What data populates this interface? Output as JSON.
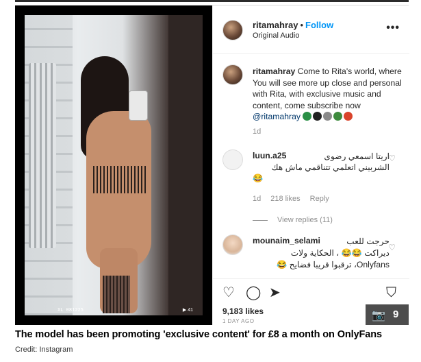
{
  "post": {
    "header": {
      "username": "ritamahray",
      "separator": "•",
      "follow_label": "Follow",
      "subtitle": "Original Audio",
      "more_label": "•••"
    },
    "caption": {
      "username": "ritamahray",
      "text": "Come to Rita's world, where You will see more up close and personal with Rita, with exclusive music and content, come subscribe now",
      "mention": "@ritamahray",
      "age": "1d",
      "emoji_colors": [
        "#2a8f46",
        "#222222",
        "#6b6b6b",
        "#3d8a3d",
        "#d9442b"
      ]
    },
    "comments": [
      {
        "username": "luun.a25",
        "text_line1": "اريتا اسمعي رضوى",
        "text_line2": "الشربيني اتعلمي تتناقمي ماش هك",
        "age": "1d",
        "likes": "218 likes",
        "reply_label": "Reply",
        "view_replies": "View replies (11)"
      },
      {
        "username": "mounaim_selami",
        "text_line1": "حرجت للعب",
        "text_line2": "ديراكت 😂😂 ، الحكاية ولات",
        "text_line3": "Onlyfans، ترقبوا قريبا فضايح 😂"
      }
    ],
    "likes_count": "9,183 likes",
    "timestamp": "1 DAY AGO"
  },
  "video": {
    "tag_text": "XL 081225",
    "play_text": "▶ 41"
  },
  "gallery": {
    "count": "9",
    "camera_icon": "📷"
  },
  "article": {
    "caption": "The model has been promoting 'exclusive content' for £8 a month on OnlyFans",
    "credit": "Credit: Instagram"
  }
}
